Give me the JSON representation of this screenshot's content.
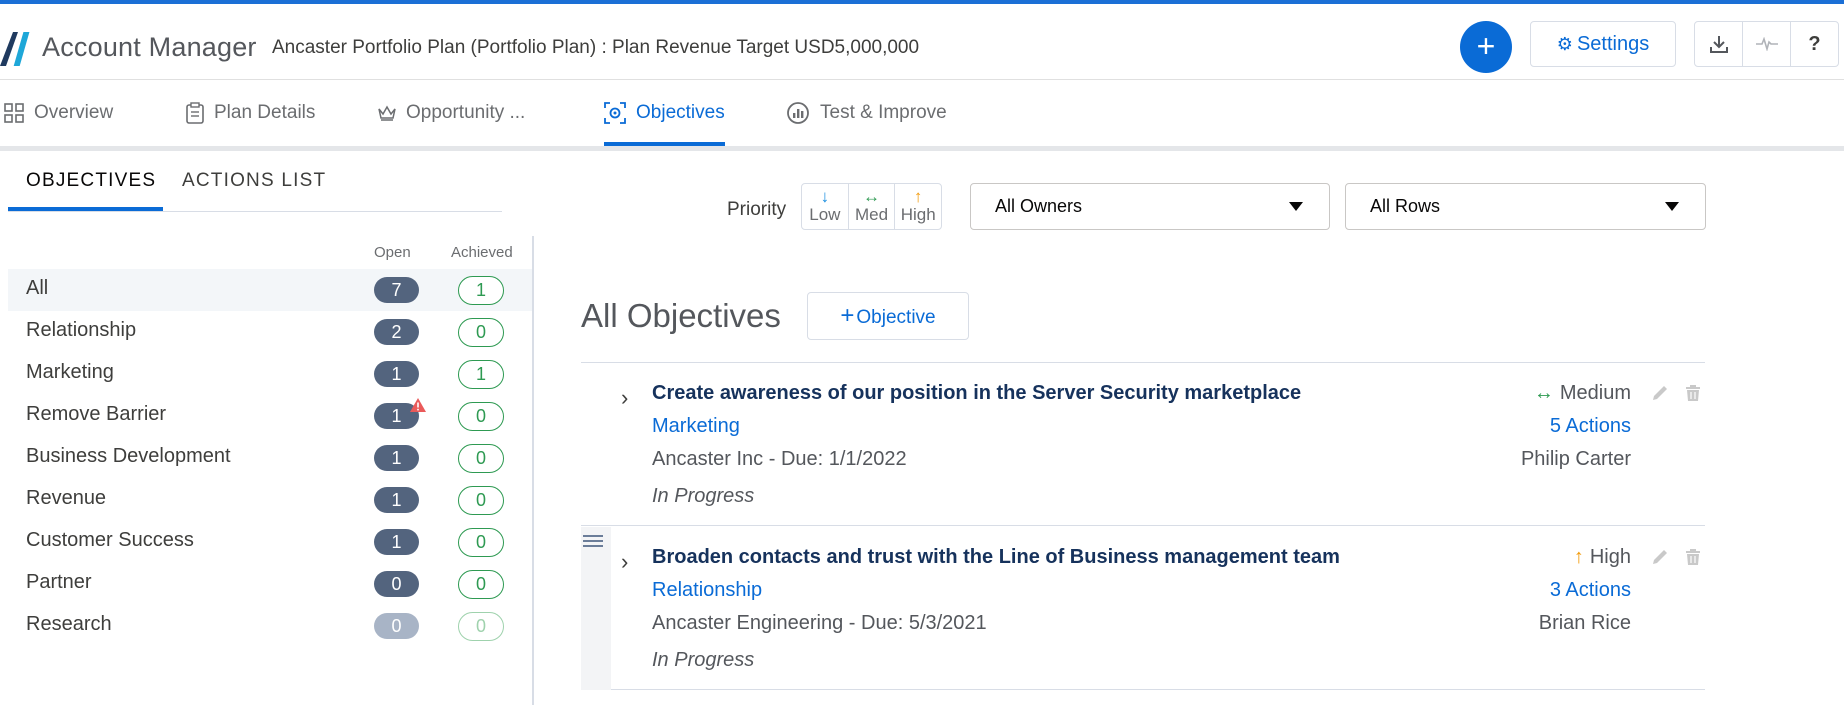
{
  "header": {
    "app_title": "Account Manager",
    "plan_title": "Ancaster Portfolio Plan (Portfolio Plan) : Plan Revenue Target USD5,000,000",
    "add_label": "+",
    "settings_label": "Settings"
  },
  "tabs": [
    {
      "label": "Overview"
    },
    {
      "label": "Plan Details"
    },
    {
      "label": "Opportunity ..."
    },
    {
      "label": "Objectives"
    },
    {
      "label": "Test & Improve"
    }
  ],
  "subtabs": [
    {
      "label": "OBJECTIVES"
    },
    {
      "label": "ACTIONS LIST"
    }
  ],
  "columns": {
    "open": "Open",
    "achieved": "Achieved"
  },
  "categories": [
    {
      "label": "All",
      "open": "7",
      "achieved": "1"
    },
    {
      "label": "Relationship",
      "open": "2",
      "achieved": "0"
    },
    {
      "label": "Marketing",
      "open": "1",
      "achieved": "1"
    },
    {
      "label": "Remove Barrier",
      "open": "1",
      "achieved": "0"
    },
    {
      "label": "Business Development",
      "open": "1",
      "achieved": "0"
    },
    {
      "label": "Revenue",
      "open": "1",
      "achieved": "0"
    },
    {
      "label": "Customer Success",
      "open": "1",
      "achieved": "0"
    },
    {
      "label": "Partner",
      "open": "0",
      "achieved": "0"
    },
    {
      "label": "Research",
      "open": "0",
      "achieved": "0"
    }
  ],
  "filters": {
    "priority_label": "Priority",
    "priorities": [
      {
        "label": "Low",
        "arrow": "↓",
        "color": "#1b8fe0"
      },
      {
        "label": "Med",
        "arrow": "↔",
        "color": "#2e9a52"
      },
      {
        "label": "High",
        "arrow": "↑",
        "color": "#f29b0c"
      }
    ],
    "owners": "All Owners",
    "rows": "All Rows"
  },
  "main": {
    "title": "All Objectives",
    "add_objective": "Objective"
  },
  "objectives": [
    {
      "title": "Create awareness of our position in the Server Security marketplace",
      "category": "Marketing",
      "account": "Ancaster Inc",
      "due": "- Due: 1/1/2022",
      "status": "In Progress",
      "priority": "Medium",
      "priority_arrow": "↔",
      "priority_color": "#2e9a52",
      "actions": "5 Actions",
      "owner": "Philip Carter"
    },
    {
      "title": "Broaden contacts and trust with the Line of Business management team",
      "category": "Relationship",
      "account": "Ancaster Engineering",
      "due": "- Due: 5/3/2021",
      "status": "In Progress",
      "priority": "High",
      "priority_arrow": "↑",
      "priority_color": "#f29b0c",
      "actions": "3 Actions",
      "owner": "Brian Rice"
    }
  ]
}
